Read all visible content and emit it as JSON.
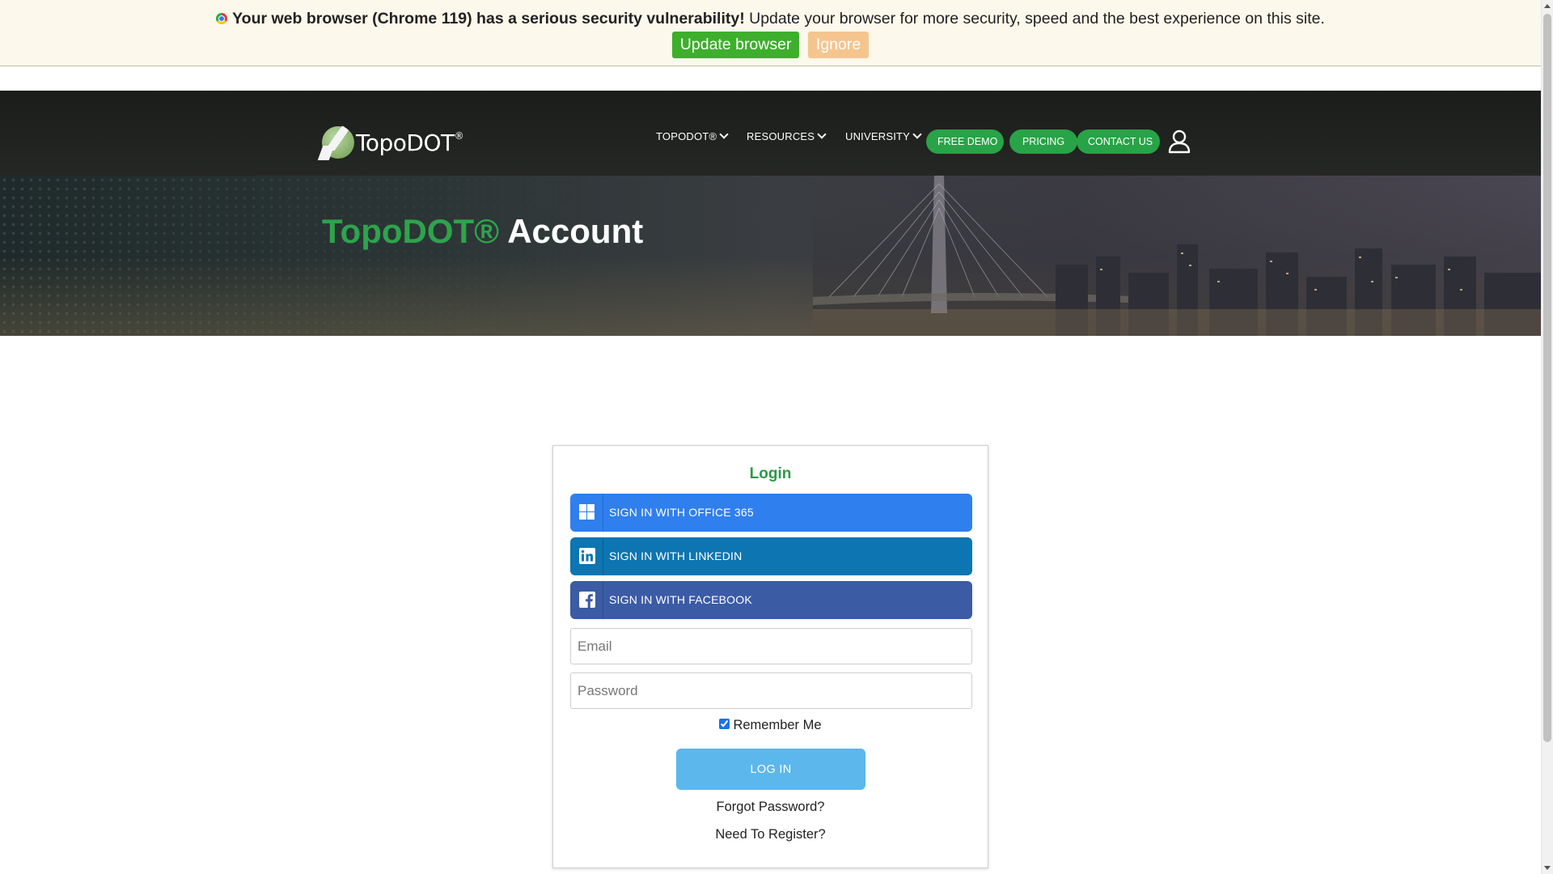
{
  "warning": {
    "bold_text": "Your web browser (Chrome 119) has a serious security vulnerability!",
    "text": " Update your browser for more security, speed and the best experience on this site.",
    "update_label": "Update browser",
    "ignore_label": "Ignore"
  },
  "header": {
    "logo_text": "TopoDOT",
    "logo_sup": "®",
    "nav": [
      {
        "label": "TOPODOT®"
      },
      {
        "label": "RESOURCES"
      },
      {
        "label": "UNIVERSITY"
      }
    ],
    "buttons": {
      "free_demo": "FREE DEMO",
      "pricing": "PRICING",
      "contact_us": "CONTACT US"
    },
    "user_icon": "user-icon"
  },
  "hero": {
    "title_brand": "TopoDOT®",
    "title_rest": " Account"
  },
  "login": {
    "title": "Login",
    "sso": {
      "office": "SIGN IN WITH OFFICE 365",
      "linkedin": "SIGN IN WITH LINKEDIN",
      "facebook": "SIGN IN WITH FACEBOOK"
    },
    "email_placeholder": "Email",
    "password_placeholder": "Password",
    "remember_label": "Remember Me",
    "remember_checked": true,
    "login_button": "LOG IN",
    "forgot": "Forgot Password?",
    "register": "Need To Register?"
  },
  "colors": {
    "brand_green": "#2ea34c",
    "office_blue": "#2f7fee",
    "linkedin_blue": "#0d75b2",
    "facebook_blue": "#3b5ba5",
    "login_button": "#5bb7ec"
  }
}
